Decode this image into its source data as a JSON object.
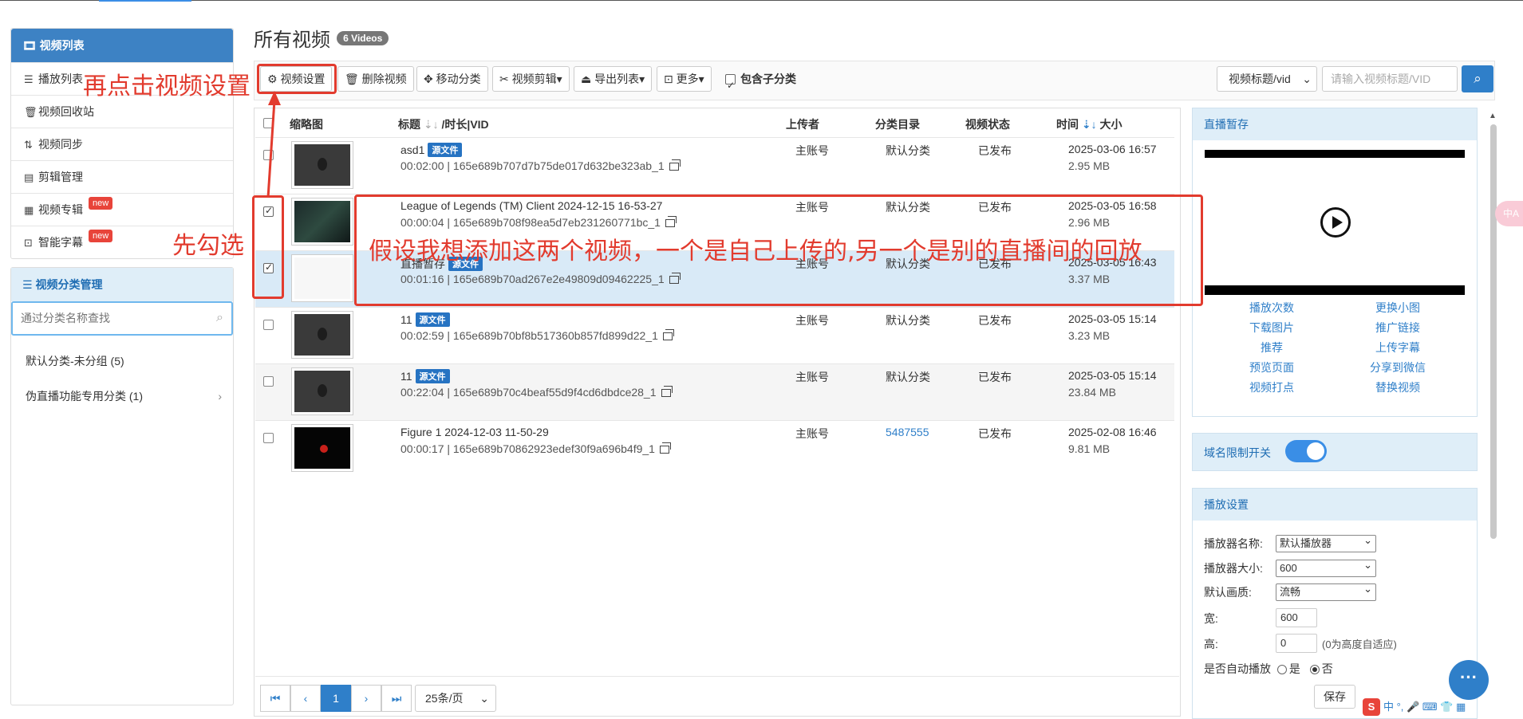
{
  "sidebar": {
    "items": [
      {
        "label": "视频列表",
        "icon": "film-icon"
      },
      {
        "label": "播放列表",
        "icon": "list-icon"
      },
      {
        "label": "视频回收站",
        "icon": "trash-icon"
      },
      {
        "label": "视频同步",
        "icon": "sync-icon"
      },
      {
        "label": "剪辑管理",
        "icon": "clip-icon"
      },
      {
        "label": "视频专辑",
        "icon": "grid-icon",
        "badge": "new"
      },
      {
        "label": "智能字幕",
        "icon": "subtitle-icon",
        "badge": "new"
      }
    ],
    "category_title": "视频分类管理",
    "category_search_placeholder": "通过分类名称查找",
    "categories": [
      "默认分类-未分组 (5)",
      "伪直播功能专用分类 (1)"
    ]
  },
  "main": {
    "title": "所有视频",
    "count_badge": "6 Videos",
    "toolbar": {
      "settings": "视频设置",
      "delete": "删除视频",
      "move": "移动分类",
      "clip": "视频剪辑",
      "export": "导出列表",
      "more": "更多",
      "include_sub": "包含子分类",
      "search_field": "视频标题/vid",
      "search_placeholder": "请输入视频标题/VID"
    },
    "columns": {
      "thumb": "缩略图",
      "title": "标题",
      "title_extra": "/时长|VID",
      "uploader": "上传者",
      "category": "分类目录",
      "status": "视频状态",
      "time": "时间",
      "size": "大小"
    },
    "rows": [
      {
        "title": "asd1",
        "src": "源文件",
        "duration": "00:02:00",
        "vid": "165e689b707d7b75de017d632be323ab_1",
        "uploader": "主账号",
        "category": "默认分类",
        "status": "已发布",
        "time": "2025-03-06 16:57",
        "size": "2.95 MB",
        "checked": false
      },
      {
        "title": "League of Legends (TM) Client 2024-12-15 16-53-27",
        "src": "",
        "duration": "00:00:04",
        "vid": "165e689b708f98ea5d7eb231260771bc_1",
        "uploader": "主账号",
        "category": "默认分类",
        "status": "已发布",
        "time": "2025-03-05 16:58",
        "size": "2.96 MB",
        "checked": true
      },
      {
        "title": "直播暂存",
        "src": "源文件",
        "duration": "00:01:16",
        "vid": "165e689b70ad267e2e49809d09462225_1",
        "uploader": "主账号",
        "category": "默认分类",
        "status": "已发布",
        "time": "2025-03-05 16:43",
        "size": "3.37 MB",
        "checked": true
      },
      {
        "title": "11",
        "src": "源文件",
        "duration": "00:02:59",
        "vid": "165e689b70bf8b517360b857fd899d22_1",
        "uploader": "主账号",
        "category": "默认分类",
        "status": "已发布",
        "time": "2025-03-05 15:14",
        "size": "3.23 MB",
        "checked": false
      },
      {
        "title": "11",
        "src": "源文件",
        "duration": "00:22:04",
        "vid": "165e689b70c4beaf55d9f4cd6dbdce28_1",
        "uploader": "主账号",
        "category": "默认分类",
        "status": "已发布",
        "time": "2025-03-05 15:14",
        "size": "23.84 MB",
        "checked": false
      },
      {
        "title": "Figure 1 2024-12-03 11-50-29",
        "src": "",
        "duration": "00:00:17",
        "vid": "165e689b70862923edef30f9a696b4f9_1",
        "uploader": "主账号",
        "category": "5487555",
        "status": "已发布",
        "time": "2025-02-08 16:46",
        "size": "9.81 MB",
        "checked": false
      }
    ],
    "pager": {
      "current": "1",
      "page_size": "25条/页"
    }
  },
  "right": {
    "live_title": "直播暂存",
    "links": [
      "播放次数",
      "更换小图",
      "下载图片",
      "推广链接",
      "推荐",
      "上传字幕",
      "预览页面",
      "分享到微信",
      "视频打点",
      "替换视频"
    ],
    "domain_label": "域名限制开关",
    "player_title": "播放设置",
    "player_name_label": "播放器名称:",
    "player_name": "默认播放器",
    "player_size_label": "播放器大小:",
    "player_size": "600",
    "quality_label": "默认画质:",
    "quality": "流畅",
    "width_label": "宽:",
    "width": "600",
    "height_label": "高:",
    "height": "0",
    "height_hint": "(0为高度自适应)",
    "autoplay_label": "是否自动播放",
    "yes": "是",
    "no": "否",
    "save": "保存"
  },
  "annotations": {
    "step2": "再点击视频设置",
    "step1": "先勾选",
    "note": "假设我想添加这两个视频，一个是自己上传的,另一个是别的直播间的回放"
  },
  "misc": {
    "chat": "···",
    "side_tab": "中A",
    "ime": "中 °, 🎤 ⌨ 👕 ▦"
  },
  "colors": {
    "primary": "#3d82c4",
    "link": "#2f7fc9",
    "annotation": "#e23b2e",
    "selected_row": "#d9eaf7",
    "new_badge": "#e8443a"
  }
}
